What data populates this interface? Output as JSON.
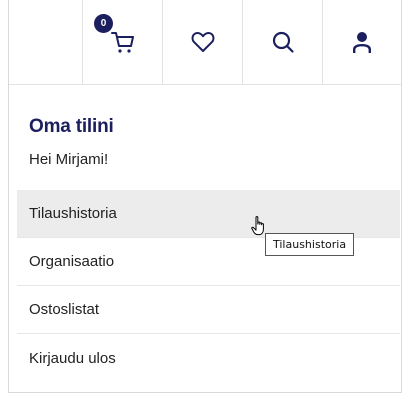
{
  "header": {
    "cart_count": "0",
    "icons": [
      "cart-icon",
      "heart-icon",
      "search-icon",
      "user-icon"
    ]
  },
  "account": {
    "title": "Oma tilini",
    "greeting": "Hei Mirjami!"
  },
  "menu": {
    "items": [
      {
        "label": "Tilaushistoria"
      },
      {
        "label": "Organisaatio"
      },
      {
        "label": "Ostoslistat"
      },
      {
        "label": "Kirjaudu ulos"
      }
    ],
    "hovered_index": 0
  },
  "tooltip": {
    "text": "Tilaushistoria"
  },
  "colors": {
    "brand": "#1b1f5e",
    "hover_bg": "#ececec"
  }
}
